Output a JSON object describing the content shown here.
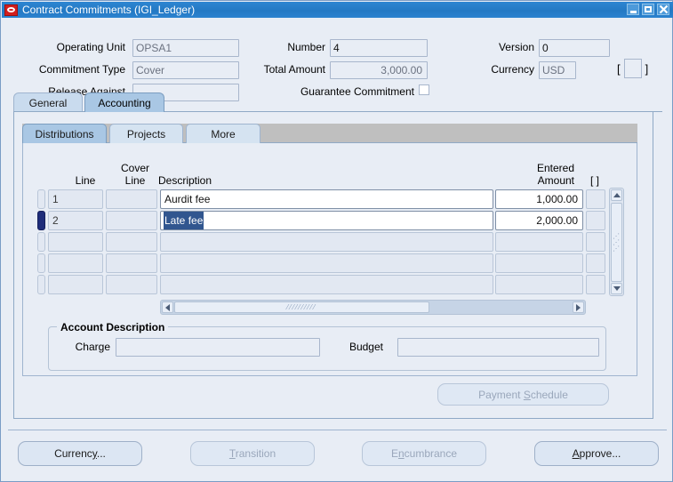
{
  "window": {
    "title": "Contract Commitments (IGI_Ledger)",
    "logo_icon": "oracle-logo-icon",
    "controls": {
      "minimize": "minimize-icon",
      "maximize": "maximize-icon",
      "close": "close-icon"
    },
    "colors": {
      "titlebar": "#2479c4",
      "canvas": "#e8edf5",
      "selected_tab": "#a9c7e4",
      "current_record": "#1f2d7a",
      "text_selection": "#31568f"
    }
  },
  "header": {
    "operating_unit": {
      "label": "Operating Unit",
      "value": "OPSA1"
    },
    "commitment_type": {
      "label": "Commitment Type",
      "value": "Cover"
    },
    "release_against": {
      "label": "Release Against",
      "value": ""
    },
    "number": {
      "label": "Number",
      "value": "4"
    },
    "total_amount": {
      "label": "Total Amount",
      "value": "3,000.00"
    },
    "guarantee_commitment": {
      "label": "Guarantee Commitment",
      "checked": false
    },
    "version": {
      "label": "Version",
      "value": "0"
    },
    "currency": {
      "label": "Currency",
      "value": "USD"
    },
    "descriptive_flexfield": {
      "open_bracket": "[",
      "close_bracket": "]",
      "value": ""
    }
  },
  "tabs": {
    "items": [
      {
        "label": "General",
        "selected": false
      },
      {
        "label": "Accounting",
        "selected": true
      }
    ]
  },
  "inner_tabs": {
    "items": [
      {
        "label": "Distributions",
        "selected": true
      },
      {
        "label": "Projects",
        "selected": false
      },
      {
        "label": "More",
        "selected": false
      }
    ]
  },
  "grid": {
    "headers": {
      "line": "Line",
      "cover_line_1": "Cover",
      "cover_line_2": "Line",
      "description": "Description",
      "entered_amount_1": "Entered",
      "entered_amount_2": "Amount",
      "flex_open": "[",
      "flex_close": "]"
    },
    "rows": [
      {
        "line": "1",
        "cover_line": "",
        "description": "Aurdit fee",
        "amount": "1,000.00",
        "flex": "",
        "current": false,
        "filled": true,
        "description_selected": false
      },
      {
        "line": "2",
        "cover_line": "",
        "description": "Late fee",
        "amount": "2,000.00",
        "flex": "",
        "current": true,
        "filled": true,
        "description_selected": true
      },
      {
        "line": "",
        "cover_line": "",
        "description": "",
        "amount": "",
        "flex": "",
        "current": false,
        "filled": false,
        "description_selected": false
      },
      {
        "line": "",
        "cover_line": "",
        "description": "",
        "amount": "",
        "flex": "",
        "current": false,
        "filled": false,
        "description_selected": false
      },
      {
        "line": "",
        "cover_line": "",
        "description": "",
        "amount": "",
        "flex": "",
        "current": false,
        "filled": false,
        "description_selected": false
      }
    ]
  },
  "account_description": {
    "title": "Account Description",
    "charge": {
      "label": "Charge",
      "value": ""
    },
    "budget": {
      "label": "Budget",
      "value": ""
    },
    "payment_schedule_button": {
      "label": "Payment Schedule",
      "enabled": false,
      "mnemonic": "S"
    }
  },
  "footer": {
    "buttons": [
      {
        "label": "Currency...",
        "enabled": true,
        "mnemonic": "y"
      },
      {
        "label": "Transition",
        "enabled": false,
        "mnemonic": "T"
      },
      {
        "label": "Encumbrance",
        "enabled": false,
        "mnemonic": "n"
      },
      {
        "label": "Approve...",
        "enabled": true,
        "mnemonic": "A"
      }
    ]
  }
}
